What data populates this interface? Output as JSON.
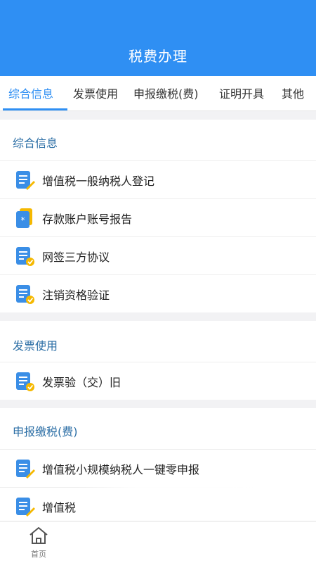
{
  "header": {
    "title": "税费办理"
  },
  "tabs": [
    {
      "label": "综合信息",
      "active": true
    },
    {
      "label": "发票使用"
    },
    {
      "label": "申报缴税(费)"
    },
    {
      "label": "证明开具"
    },
    {
      "label": "其他"
    }
  ],
  "sections": [
    {
      "title": "综合信息",
      "items": [
        {
          "label": "增值税一般纳税人登记",
          "icon": "document-edit-icon"
        },
        {
          "label": "存款账户账号报告",
          "icon": "bank-book-icon"
        },
        {
          "label": "网签三方协议",
          "icon": "document-check-icon"
        },
        {
          "label": "注销资格验证",
          "icon": "document-check-icon"
        }
      ]
    },
    {
      "title": "发票使用",
      "items": [
        {
          "label": "发票验（交）旧",
          "icon": "document-check-icon"
        }
      ]
    },
    {
      "title": "申报缴税(费)",
      "items": [
        {
          "label": "增值税小规模纳税人一键零申报",
          "icon": "document-edit-icon"
        },
        {
          "label": "增值税",
          "icon": "document-edit-icon"
        }
      ]
    }
  ],
  "bottom_nav": {
    "home_label": "首页"
  },
  "colors": {
    "primary": "#2f8ff3",
    "section_title": "#2b6ea5",
    "icon_blue": "#3a8ee6",
    "icon_yellow": "#f5b800"
  }
}
